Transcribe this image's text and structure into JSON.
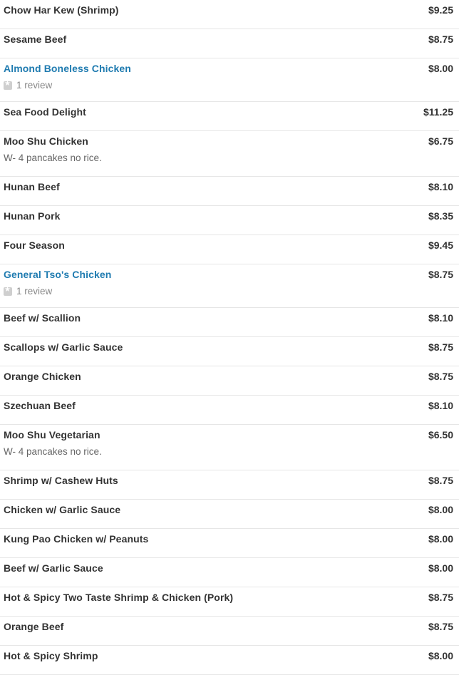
{
  "menu": {
    "items": [
      {
        "name": "Chow Har Kew (Shrimp)",
        "price": "$9.25"
      },
      {
        "name": "Sesame Beef",
        "price": "$8.75"
      },
      {
        "name": "Almond Boneless Chicken",
        "price": "$8.00",
        "link": true,
        "review": "1 review"
      },
      {
        "name": "Sea Food Delight",
        "price": "$11.25"
      },
      {
        "name": "Moo Shu Chicken",
        "price": "$6.75",
        "description": "W- 4 pancakes no rice."
      },
      {
        "name": "Hunan Beef",
        "price": "$8.10"
      },
      {
        "name": "Hunan Pork",
        "price": "$8.35"
      },
      {
        "name": "Four Season",
        "price": "$9.45"
      },
      {
        "name": "General Tso's Chicken",
        "price": "$8.75",
        "link": true,
        "review": "1 review"
      },
      {
        "name": "Beef w/ Scallion",
        "price": "$8.10"
      },
      {
        "name": "Scallops w/ Garlic Sauce",
        "price": "$8.75"
      },
      {
        "name": "Orange Chicken",
        "price": "$8.75"
      },
      {
        "name": "Szechuan Beef",
        "price": "$8.10"
      },
      {
        "name": "Moo Shu Vegetarian",
        "price": "$6.50",
        "description": "W- 4 pancakes no rice."
      },
      {
        "name": "Shrimp w/ Cashew Huts",
        "price": "$8.75"
      },
      {
        "name": "Chicken w/ Garlic Sauce",
        "price": "$8.00"
      },
      {
        "name": "Kung Pao Chicken w/ Peanuts",
        "price": "$8.00"
      },
      {
        "name": "Beef w/ Garlic Sauce",
        "price": "$8.00"
      },
      {
        "name": "Hot & Spicy Two Taste Shrimp & Chicken (Pork)",
        "price": "$8.75"
      },
      {
        "name": "Orange Beef",
        "price": "$8.75"
      },
      {
        "name": "Hot & Spicy Shrimp",
        "price": "$8.00"
      }
    ]
  }
}
